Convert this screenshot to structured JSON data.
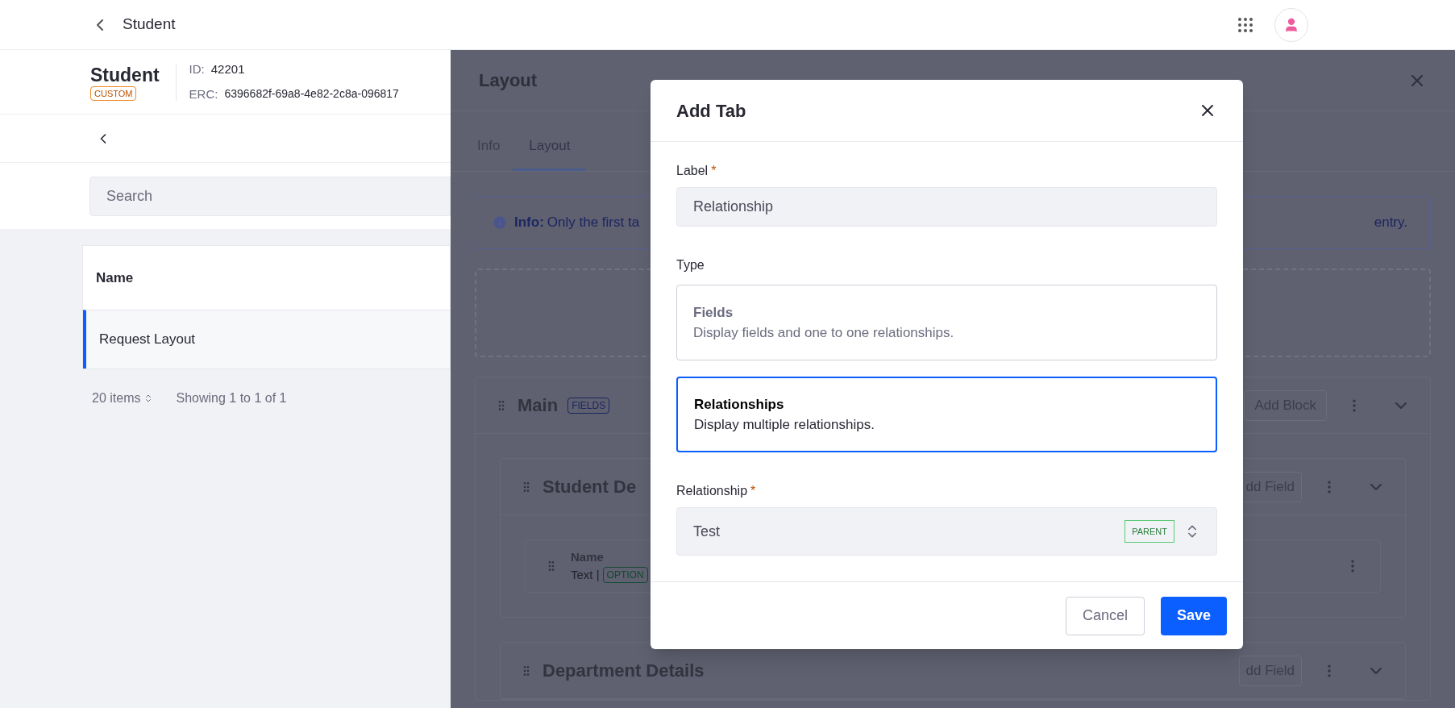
{
  "top_bar": {
    "title": "Student"
  },
  "object_header": {
    "name": "Student",
    "badge": "CUSTOM",
    "id_label": "ID:",
    "id_value": "42201",
    "erc_label": "ERC:",
    "erc_value": "6396682f-69a8-4e82-2c8a-096817"
  },
  "search": {
    "placeholder": "Search"
  },
  "table": {
    "column": "Name",
    "rows": [
      {
        "name": "Request Layout",
        "selected": true
      }
    ]
  },
  "pagination": {
    "page_size": "20 items",
    "summary": "Showing 1 to 1 of 1"
  },
  "side_panel": {
    "title": "Layout",
    "tabs": [
      {
        "label": "Info",
        "selected": false
      },
      {
        "label": "Layout",
        "selected": true
      }
    ],
    "alert": {
      "label": "Info:",
      "text_start": "Only the first ta",
      "text_end": "entry."
    },
    "block": {
      "title": "Main",
      "badge": "FIELDS",
      "button": "Add Block",
      "children": [
        {
          "title": "Student De",
          "button": "dd Field",
          "fields": [
            {
              "name": "Name",
              "type": "Text |",
              "badge": "OPTION"
            }
          ]
        },
        {
          "title": "Department Details",
          "button": "dd Field"
        }
      ]
    }
  },
  "modal": {
    "title": "Add Tab",
    "label_field": {
      "label": "Label",
      "required": true,
      "required_mark": "*",
      "value": "Relationship"
    },
    "type_label": "Type",
    "type_options": [
      {
        "title": "Fields",
        "description": "Display fields and one to one relationships.",
        "selected": false
      },
      {
        "title": "Relationships",
        "description": "Display multiple relationships.",
        "selected": true
      }
    ],
    "relationship_field": {
      "label": "Relationship",
      "required": true,
      "required_mark": "*",
      "value": "Test",
      "badge": "PARENT"
    },
    "buttons": [
      {
        "label": "Cancel",
        "kind": "secondary"
      },
      {
        "label": "Save",
        "kind": "primary"
      }
    ]
  }
}
